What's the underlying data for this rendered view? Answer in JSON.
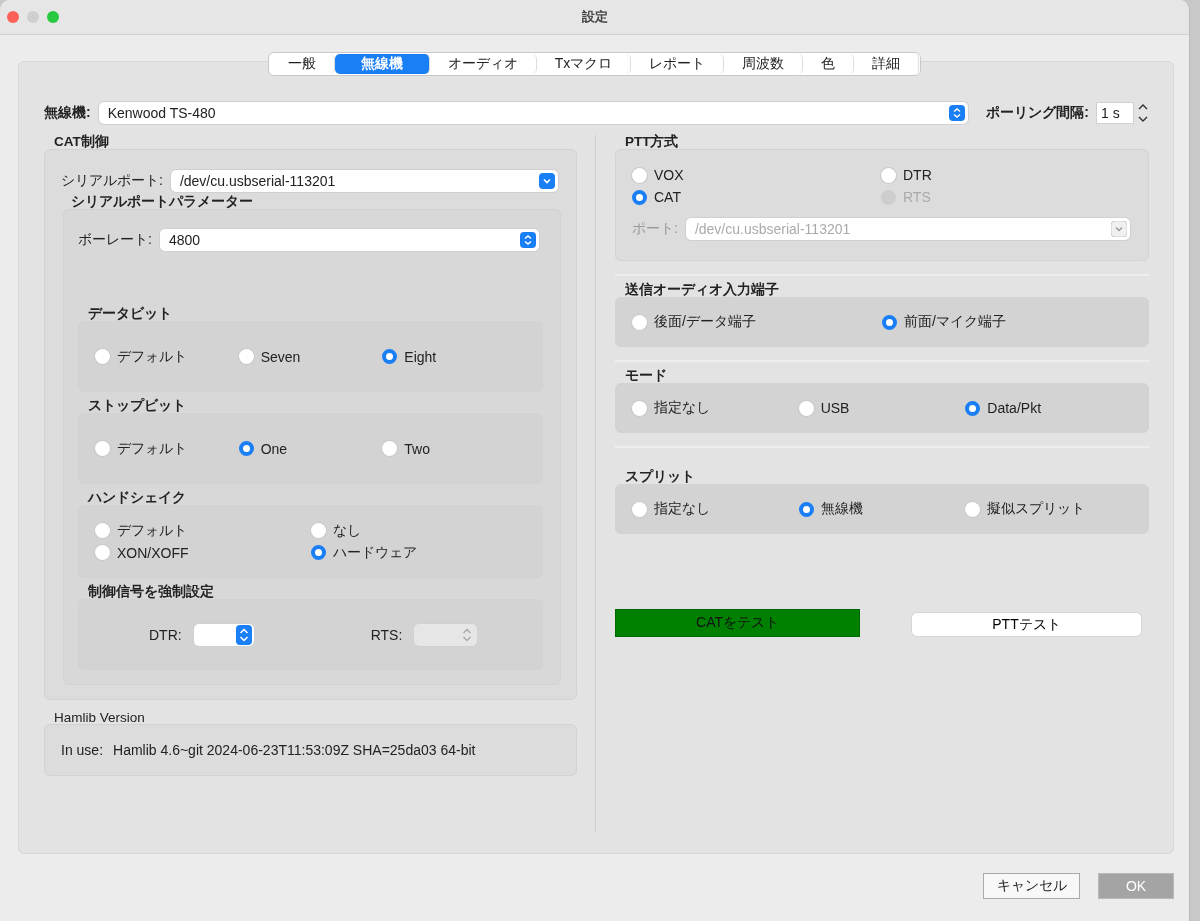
{
  "window": {
    "title": "設定"
  },
  "tabs": [
    {
      "label": "一般",
      "selected": false
    },
    {
      "label": "無線機",
      "selected": true
    },
    {
      "label": "オーディオ",
      "selected": false
    },
    {
      "label": "Txマクロ",
      "selected": false
    },
    {
      "label": "レポート",
      "selected": false
    },
    {
      "label": "周波数",
      "selected": false
    },
    {
      "label": "色",
      "selected": false
    },
    {
      "label": "詳細",
      "selected": false
    }
  ],
  "rig": {
    "label": "無線機:",
    "value": "Kenwood TS-480"
  },
  "polling": {
    "label": "ポーリング間隔:",
    "value": "1 s"
  },
  "cat_control": {
    "title": "CAT制御",
    "serial_port": {
      "label": "シリアルポート:",
      "value": "/dev/cu.usbserial-113201"
    },
    "parameters": {
      "title": "シリアルポートパラメーター",
      "baud_rate": {
        "label": "ボーレート:",
        "value": "4800"
      },
      "groups": [
        {
          "title": "データビット",
          "kind": "row",
          "options": [
            {
              "label": "デフォルト",
              "selected": false
            },
            {
              "label": "Seven",
              "selected": false
            },
            {
              "label": "Eight",
              "selected": true
            }
          ]
        },
        {
          "title": "ストップビット",
          "kind": "row",
          "options": [
            {
              "label": "デフォルト",
              "selected": false
            },
            {
              "label": "One",
              "selected": true
            },
            {
              "label": "Two",
              "selected": false
            }
          ]
        },
        {
          "title": "ハンドシェイク",
          "kind": "grid",
          "options": [
            {
              "label": "デフォルト",
              "selected": false
            },
            {
              "label": "なし",
              "selected": false
            },
            {
              "label": "XON/XOFF",
              "selected": false
            },
            {
              "label": "ハードウェア",
              "selected": true
            }
          ]
        }
      ],
      "force_signals": {
        "title": "制御信号を強制設定",
        "dtr": {
          "label": "DTR:",
          "disabled": false
        },
        "rts": {
          "label": "RTS:",
          "disabled": true
        }
      }
    }
  },
  "hamlib": {
    "title": "Hamlib Version",
    "label": "In use:",
    "value": "Hamlib 4.6~git 2024-06-23T11:53:09Z SHA=25da03 64-bit"
  },
  "ptt": {
    "title": "PTT方式",
    "options": [
      {
        "label": "VOX",
        "selected": false,
        "disabled": false
      },
      {
        "label": "DTR",
        "selected": false,
        "disabled": false
      },
      {
        "label": "CAT",
        "selected": true,
        "disabled": false
      },
      {
        "label": "RTS",
        "selected": false,
        "disabled": true
      }
    ],
    "port": {
      "label": "ポート:",
      "value": "/dev/cu.usbserial-113201",
      "disabled": true
    }
  },
  "sections": [
    {
      "title": "送信オーディオ入力端子",
      "kind": "row",
      "options": [
        {
          "label": "後面/データ端子",
          "selected": false
        },
        {
          "label": "前面/マイク端子",
          "selected": true
        }
      ]
    },
    {
      "title": "モード",
      "kind": "row",
      "options": [
        {
          "label": "指定なし",
          "selected": false
        },
        {
          "label": "USB",
          "selected": false
        },
        {
          "label": "Data/Pkt",
          "selected": true
        }
      ]
    },
    {
      "title": "スプリット",
      "kind": "row",
      "options": [
        {
          "label": "指定なし",
          "selected": false
        },
        {
          "label": "無線機",
          "selected": true
        },
        {
          "label": "擬似スプリット",
          "selected": false
        }
      ]
    }
  ],
  "tests": [
    {
      "label": "CATをテスト",
      "success": true
    },
    {
      "label": "PTTテスト",
      "success": false
    }
  ],
  "footer_buttons": [
    {
      "label": "キャンセル",
      "disabled": false
    },
    {
      "label": "OK",
      "disabled": true
    }
  ]
}
